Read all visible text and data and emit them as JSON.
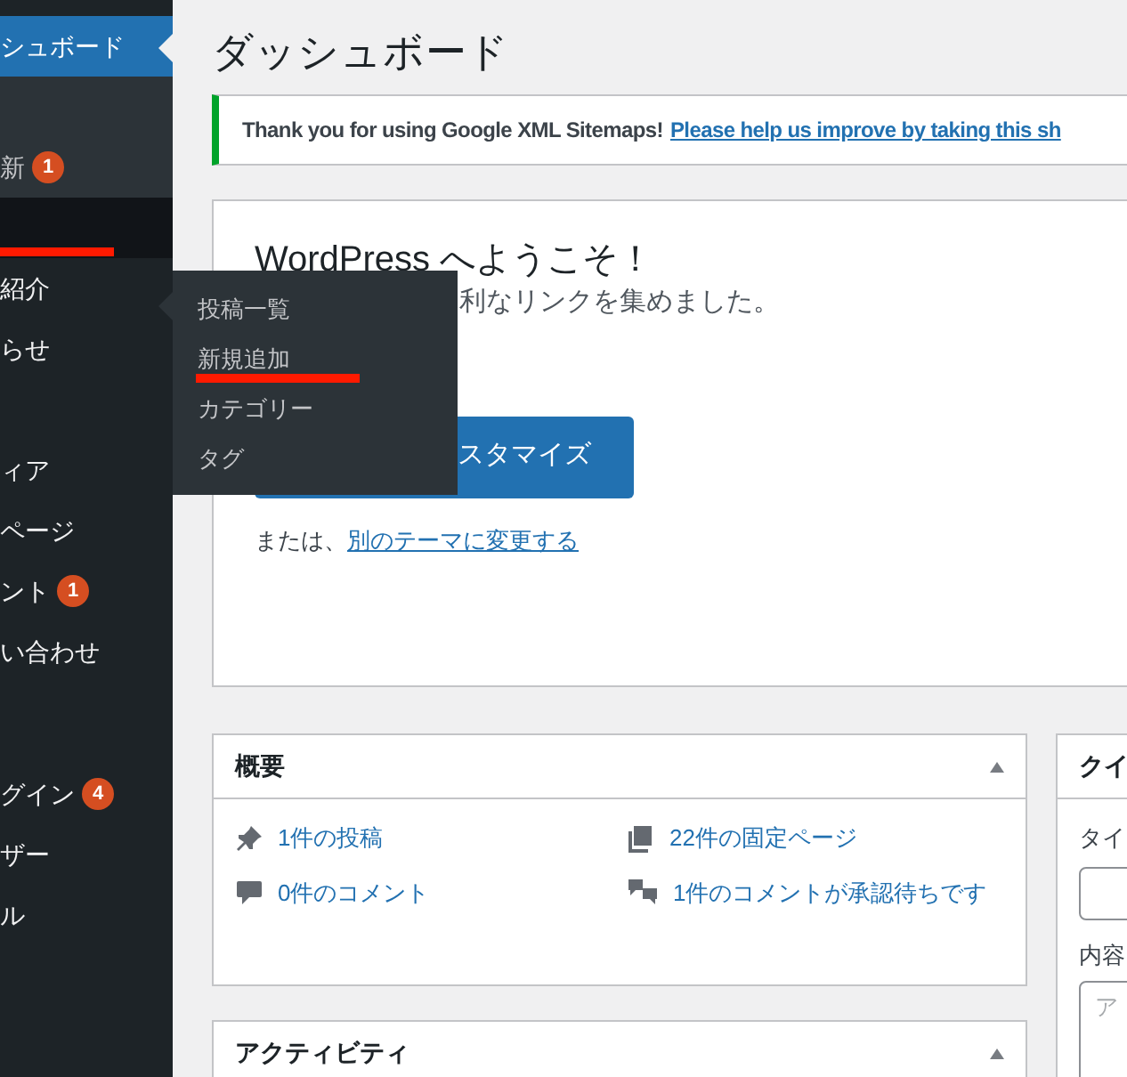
{
  "sidebar": {
    "items": [
      {
        "kind": "menu",
        "label": "シュボード",
        "selected": true
      },
      {
        "kind": "sub"
      },
      {
        "kind": "sub",
        "label": "新",
        "badge": "1"
      },
      {
        "kind": "menu",
        "hovered": true,
        "marked": true
      },
      {
        "kind": "menu",
        "label": "紹介"
      },
      {
        "kind": "menu",
        "label": "らせ"
      },
      {
        "kind": "menu"
      },
      {
        "kind": "menu",
        "label": "ィア"
      },
      {
        "kind": "menu",
        "label": "ページ"
      },
      {
        "kind": "menu",
        "label": "ント",
        "badge": "1"
      },
      {
        "kind": "menu",
        "label": "い合わせ"
      },
      {
        "kind": "separator"
      },
      {
        "kind": "menu"
      },
      {
        "kind": "menu",
        "label": "グイン",
        "badge": "4"
      },
      {
        "kind": "menu",
        "label": "ザー"
      },
      {
        "kind": "menu",
        "label": "ル"
      }
    ]
  },
  "flyout": {
    "items": [
      {
        "label": "投稿一覧",
        "marked": false
      },
      {
        "label": "新規追加",
        "marked": true
      },
      {
        "label": "カテゴリー",
        "marked": false
      },
      {
        "label": "タグ",
        "marked": false
      }
    ]
  },
  "page_title": "ダッシュボード",
  "notice": {
    "text": "Thank you for using Google XML Sitemaps!",
    "link": "Please help us improve by taking this sh"
  },
  "welcome": {
    "title": "WordPress へようこそ！",
    "subtitle": "利なリンクを集めました。",
    "button": "スタマイズ",
    "alt_text": "または、",
    "alt_link": "別のテーマに変更する"
  },
  "overview": {
    "title": "概要",
    "items": [
      {
        "text": "1件の投稿"
      },
      {
        "text": "22件の固定ページ"
      },
      {
        "text": "0件のコメント"
      },
      {
        "text": "1件のコメントが承認待ちです"
      }
    ]
  },
  "activity": {
    "title": "アクティビティ"
  },
  "quick_draft": {
    "title": "クイ",
    "title_label": "タイ",
    "content_label": "内容",
    "content_placeholder": "ア"
  }
}
